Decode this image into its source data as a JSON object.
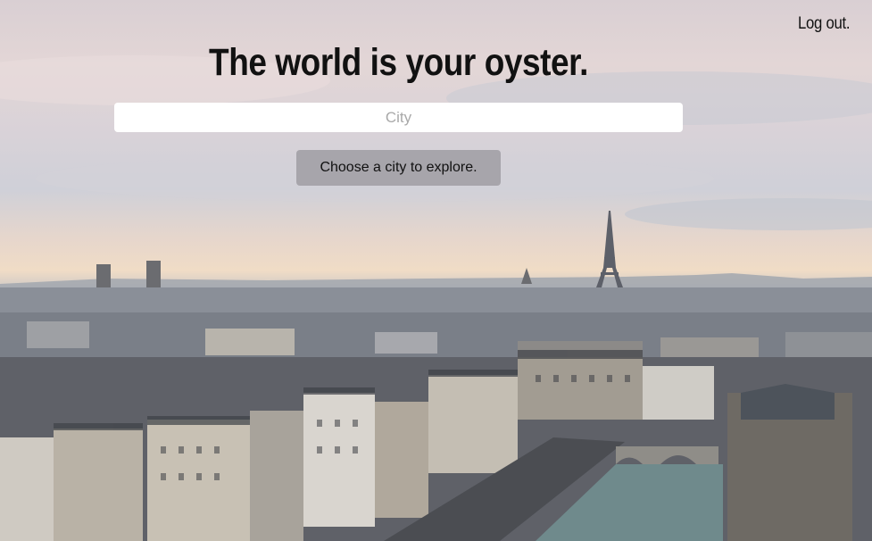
{
  "header": {
    "logout_label": "Log out."
  },
  "hero": {
    "headline": "The world is your oyster."
  },
  "search": {
    "value": "",
    "placeholder": "City"
  },
  "actions": {
    "explore_label": "Choose a city to explore."
  },
  "background": {
    "subject": "paris-cityscape-with-eiffel-tower",
    "sky_color": "#e3d6d6",
    "horizon_color": "#f0dcc6",
    "city_color": "#6c717a"
  }
}
